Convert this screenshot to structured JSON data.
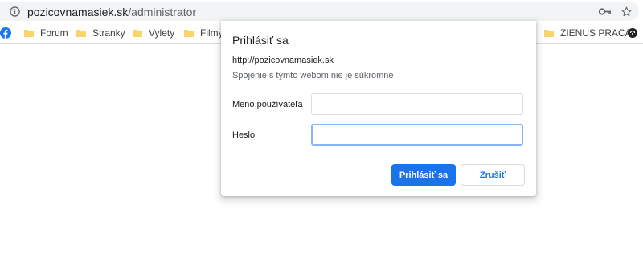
{
  "omnibox": {
    "domain": "pozicovnamasiek.sk",
    "path": "/administrator"
  },
  "bookmarks": {
    "items": [
      {
        "label": "Forum",
        "icon": "folder-icon"
      },
      {
        "label": "Stranky",
        "icon": "folder-icon"
      },
      {
        "label": "Vylety",
        "icon": "folder-icon"
      },
      {
        "label": "Filmy",
        "icon": "folder-icon"
      },
      {
        "label": "ZIENUS PRACA",
        "icon": "folder-icon"
      }
    ]
  },
  "dialog": {
    "title": "Prihlásiť sa",
    "origin": "http://pozicovnamasiek.sk",
    "note": "Spojenie s týmto webom nie je súkromné",
    "username_label": "Meno používateľa",
    "username_value": "",
    "password_label": "Heslo",
    "password_value": "",
    "login_button": "Prihlásiť sa",
    "cancel_button": "Zrušiť"
  },
  "colors": {
    "accent": "#1a73e8",
    "folder": "#f9d46b",
    "facebook": "#1877f2"
  }
}
